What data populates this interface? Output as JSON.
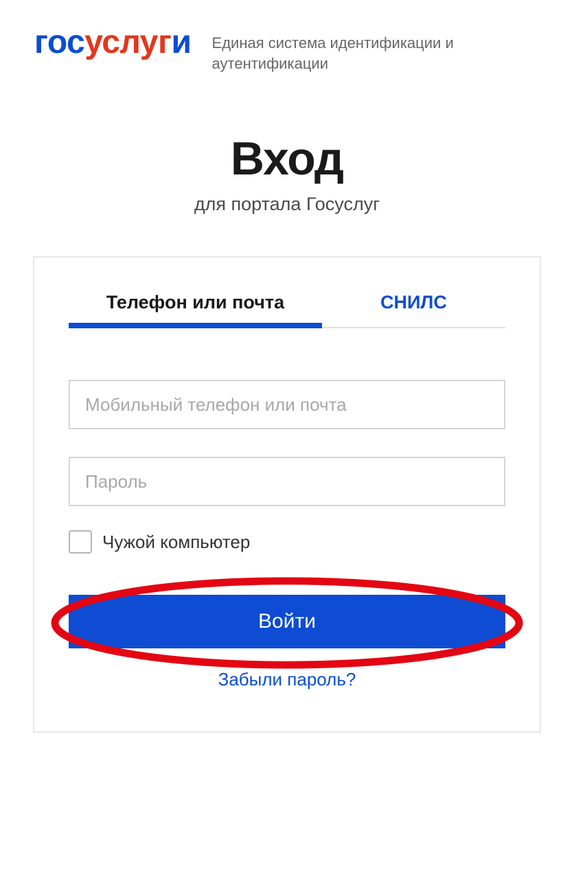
{
  "header": {
    "logo_part1": "гос",
    "logo_part2": "услуг",
    "logo_part3": "и",
    "subtitle": "Единая система идентификации и аутентификации"
  },
  "main": {
    "title": "Вход",
    "subtitle": "для портала Госуслуг"
  },
  "tabs": {
    "phone_email": "Телефон или почта",
    "snils": "СНИЛС"
  },
  "form": {
    "login_placeholder": "Мобильный телефон или почта",
    "password_placeholder": "Пароль",
    "foreign_computer_label": "Чужой компьютер",
    "submit_label": "Войти",
    "forgot_password": "Забыли пароль?"
  },
  "colors": {
    "primary_blue": "#0d4cd3",
    "accent_red": "#e3371e",
    "annotation_red": "#e30613"
  }
}
